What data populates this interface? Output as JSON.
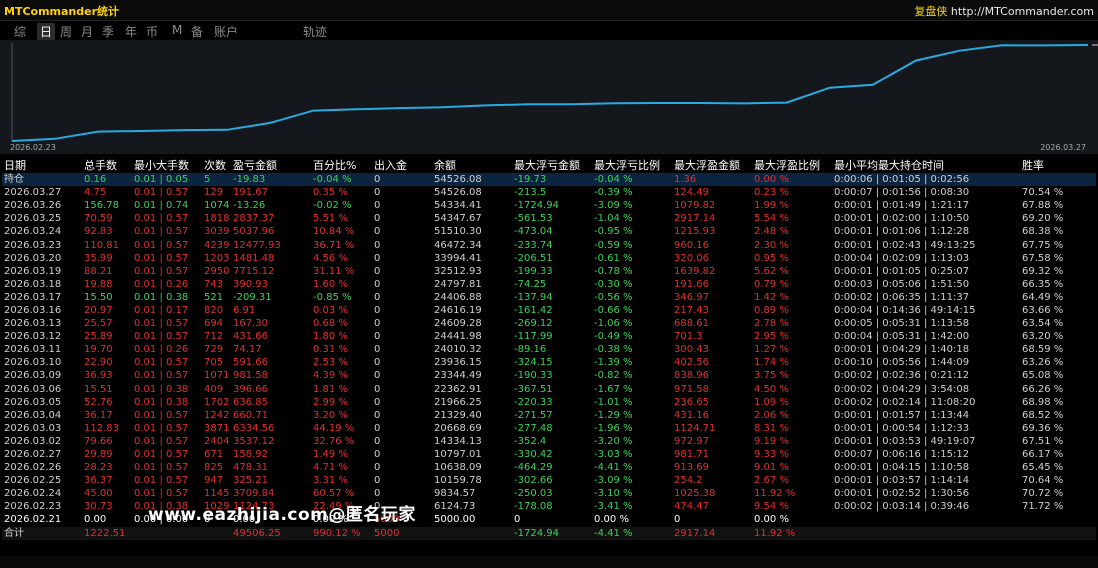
{
  "app": {
    "title": "MTCommander统计",
    "brand": "复盘侠",
    "site": "http://MTCommander.com"
  },
  "tabs": [
    {
      "label": "综",
      "active": false
    },
    {
      "label": "日",
      "active": true
    },
    {
      "label": "周",
      "active": false
    },
    {
      "label": "月",
      "active": false
    },
    {
      "label": "季",
      "active": false
    },
    {
      "label": "年",
      "active": false
    },
    {
      "label": "币",
      "active": false
    },
    {
      "label": "M",
      "active": false
    },
    {
      "label": "备",
      "active": false
    },
    {
      "label": "账户",
      "active": false
    },
    {
      "label": "轨迹",
      "active": false
    }
  ],
  "chart_data": {
    "type": "line",
    "x": [
      "2026.02.21",
      "2026.02.23",
      "2026.02.24",
      "2026.02.25",
      "2026.02.26",
      "2026.02.27",
      "2026.03.02",
      "2026.03.03",
      "2026.03.04",
      "2026.03.05",
      "2026.03.06",
      "2026.03.09",
      "2026.03.10",
      "2026.03.11",
      "2026.03.12",
      "2026.03.13",
      "2026.03.16",
      "2026.03.17",
      "2026.03.18",
      "2026.03.19",
      "2026.03.20",
      "2026.03.23",
      "2026.03.24",
      "2026.03.25",
      "2026.03.26",
      "2026.03.27"
    ],
    "values": [
      5000.0,
      6124.73,
      9834.57,
      10159.78,
      10638.09,
      10797.01,
      14334.13,
      20668.69,
      21329.4,
      21966.25,
      22362.91,
      23344.49,
      23936.15,
      24010.32,
      24441.98,
      24609.28,
      24616.19,
      24406.88,
      24797.81,
      32512.93,
      33994.41,
      46472.34,
      51510.3,
      54347.67,
      54334.41,
      54526.08
    ],
    "x_start_label": "2026.02.23",
    "x_end_label": "2026.03.27",
    "color": "#29abe2"
  },
  "table": {
    "headers": [
      "日期",
      "总手数",
      "最小大手数",
      "次数",
      "盈亏金额",
      "百分比%",
      "出入金",
      "余额",
      "最大浮亏金额",
      "最大浮亏比例",
      "最大浮盈金额",
      "最大浮盈比例",
      "最小平均最大持仓时间",
      "胜率"
    ],
    "holding": {
      "date": "持仓",
      "lots": "0.16",
      "minmax": "0.01 | 0.05",
      "count": "5",
      "pnl": "-19.83",
      "pct": "-0.04 %",
      "io": "0",
      "balance": "54526.08",
      "maxdd": "-19.73",
      "maxdd_pct": "-0.04 %",
      "maxfp": "1.36",
      "maxfp_pct": "0.00 %",
      "hold": "0:00:06 | 0:01:05 | 0:02:56",
      "win": ""
    },
    "rows": [
      {
        "date": "2026.03.27",
        "lots": "4.75",
        "minmax": "0.01 | 0.57",
        "count": "129",
        "pnl": "191.67",
        "pct": "0.35 %",
        "io": "0",
        "balance": "54526.08",
        "maxdd": "-213.5",
        "maxdd_pct": "-0.39 %",
        "maxfp": "124.49",
        "maxfp_pct": "0.23 %",
        "hold": "0:00:07 | 0:01:56 | 0:08:30",
        "win": "70.54 %"
      },
      {
        "date": "2026.03.26",
        "lots": "156.78",
        "minmax": "0.01 | 0.74",
        "count": "1074",
        "pnl": "-13.26",
        "pct": "-0.02 %",
        "io": "0",
        "balance": "54334.41",
        "maxdd": "-1724.94",
        "maxdd_pct": "-3.09 %",
        "maxfp": "1079.82",
        "maxfp_pct": "1.99 %",
        "hold": "0:00:01 | 0:01:49 | 1:21:17",
        "win": "67.88 %"
      },
      {
        "date": "2026.03.25",
        "lots": "70.59",
        "minmax": "0.01 | 0.57",
        "count": "1818",
        "pnl": "2837.37",
        "pct": "5.51 %",
        "io": "0",
        "balance": "54347.67",
        "maxdd": "-561.53",
        "maxdd_pct": "-1.04 %",
        "maxfp": "2917.14",
        "maxfp_pct": "5.54 %",
        "hold": "0:00:01 | 0:02:00 | 1:10:50",
        "win": "69.20 %"
      },
      {
        "date": "2026.03.24",
        "lots": "92.83",
        "minmax": "0.01 | 0.57",
        "count": "3039",
        "pnl": "5037.96",
        "pct": "10.84 %",
        "io": "0",
        "balance": "51510.30",
        "maxdd": "-473.04",
        "maxdd_pct": "-0.95 %",
        "maxfp": "1215.93",
        "maxfp_pct": "2.48 %",
        "hold": "0:00:01 | 0:01:06 | 1:12:28",
        "win": "68.38 %"
      },
      {
        "date": "2026.03.23",
        "lots": "110.81",
        "minmax": "0.01 | 0.57",
        "count": "4239",
        "pnl": "12477.93",
        "pct": "36.71 %",
        "io": "0",
        "balance": "46472.34",
        "maxdd": "-233.74",
        "maxdd_pct": "-0.59 %",
        "maxfp": "960.16",
        "maxfp_pct": "2.30 %",
        "hold": "0:00:01 | 0:02:43 | 49:13:25",
        "win": "67.75 %"
      },
      {
        "date": "2026.03.20",
        "lots": "35.99",
        "minmax": "0.01 | 0.57",
        "count": "1203",
        "pnl": "1481.48",
        "pct": "4.56 %",
        "io": "0",
        "balance": "33994.41",
        "maxdd": "-206.51",
        "maxdd_pct": "-0.61 %",
        "maxfp": "320.06",
        "maxfp_pct": "0.95 %",
        "hold": "0:00:04 | 0:02:09 | 1:13:03",
        "win": "67.58 %"
      },
      {
        "date": "2026.03.19",
        "lots": "88.21",
        "minmax": "0.01 | 0.57",
        "count": "2950",
        "pnl": "7715.12",
        "pct": "31.11 %",
        "io": "0",
        "balance": "32512.93",
        "maxdd": "-199.33",
        "maxdd_pct": "-0.78 %",
        "maxfp": "1639.82",
        "maxfp_pct": "5.62 %",
        "hold": "0:00:01 | 0:01:05 | 0:25:07",
        "win": "69.32 %"
      },
      {
        "date": "2026.03.18",
        "lots": "19.88",
        "minmax": "0.01 | 0.26",
        "count": "743",
        "pnl": "390.93",
        "pct": "1.60 %",
        "io": "0",
        "balance": "24797.81",
        "maxdd": "-74.25",
        "maxdd_pct": "-0.30 %",
        "maxfp": "191.66",
        "maxfp_pct": "0.79 %",
        "hold": "0:00:03 | 0:05:06 | 1:51:50",
        "win": "66.35 %"
      },
      {
        "date": "2026.03.17",
        "lots": "15.50",
        "minmax": "0.01 | 0.38",
        "count": "521",
        "pnl": "-209.31",
        "pct": "-0.85 %",
        "io": "0",
        "balance": "24406.88",
        "maxdd": "-137.94",
        "maxdd_pct": "-0.56 %",
        "maxfp": "346.97",
        "maxfp_pct": "1.42 %",
        "hold": "0:00:02 | 0:06:35 | 1:11:37",
        "win": "64.49 %"
      },
      {
        "date": "2026.03.16",
        "lots": "20.97",
        "minmax": "0.01 | 0.17",
        "count": "820",
        "pnl": "6.91",
        "pct": "0.03 %",
        "io": "0",
        "balance": "24616.19",
        "maxdd": "-161.42",
        "maxdd_pct": "-0.66 %",
        "maxfp": "217.43",
        "maxfp_pct": "0.89 %",
        "hold": "0:00:04 | 0:14:36 | 49:14:15",
        "win": "63.66 %"
      },
      {
        "date": "2026.03.13",
        "lots": "25.57",
        "minmax": "0.01 | 0.57",
        "count": "694",
        "pnl": "167.30",
        "pct": "0.68 %",
        "io": "0",
        "balance": "24609.28",
        "maxdd": "-269.12",
        "maxdd_pct": "-1.06 %",
        "maxfp": "688.61",
        "maxfp_pct": "2.78 %",
        "hold": "0:00:05 | 0:05:31 | 1:13:58",
        "win": "63.54 %"
      },
      {
        "date": "2026.03.12",
        "lots": "25.89",
        "minmax": "0.01 | 0.57",
        "count": "712",
        "pnl": "431.66",
        "pct": "1.80 %",
        "io": "0",
        "balance": "24441.98",
        "maxdd": "-117.99",
        "maxdd_pct": "-0.49 %",
        "maxfp": "701.3",
        "maxfp_pct": "2.95 %",
        "hold": "0:00:04 | 0:05:31 | 1:42:00",
        "win": "63.20 %"
      },
      {
        "date": "2026.03.11",
        "lots": "19.70",
        "minmax": "0.01 | 0.26",
        "count": "729",
        "pnl": "74.17",
        "pct": "0.31 %",
        "io": "0",
        "balance": "24010.32",
        "maxdd": "-89.16",
        "maxdd_pct": "-0.38 %",
        "maxfp": "300.43",
        "maxfp_pct": "1.27 %",
        "hold": "0:00:01 | 0:04:29 | 1:40:18",
        "win": "68.59 %"
      },
      {
        "date": "2026.03.10",
        "lots": "22.90",
        "minmax": "0.01 | 0.57",
        "count": "705",
        "pnl": "591.66",
        "pct": "2.53 %",
        "io": "0",
        "balance": "23936.15",
        "maxdd": "-324.15",
        "maxdd_pct": "-1.39 %",
        "maxfp": "402.56",
        "maxfp_pct": "1.74 %",
        "hold": "0:00:10 | 0:05:56 | 1:44:09",
        "win": "63.26 %"
      },
      {
        "date": "2026.03.09",
        "lots": "36.93",
        "minmax": "0.01 | 0.57",
        "count": "1071",
        "pnl": "981.58",
        "pct": "4.39 %",
        "io": "0",
        "balance": "23344.49",
        "maxdd": "-190.33",
        "maxdd_pct": "-0.82 %",
        "maxfp": "838.96",
        "maxfp_pct": "3.75 %",
        "hold": "0:00:02 | 0:02:36 | 0:21:12",
        "win": "65.08 %"
      },
      {
        "date": "2026.03.06",
        "lots": "15.51",
        "minmax": "0.01 | 0.38",
        "count": "409",
        "pnl": "396.66",
        "pct": "1.81 %",
        "io": "0",
        "balance": "22362.91",
        "maxdd": "-367.51",
        "maxdd_pct": "-1.67 %",
        "maxfp": "971.58",
        "maxfp_pct": "4.50 %",
        "hold": "0:00:02 | 0:04:29 | 3:54:08",
        "win": "66.26 %"
      },
      {
        "date": "2026.03.05",
        "lots": "52.76",
        "minmax": "0.01 | 0.38",
        "count": "1702",
        "pnl": "636.85",
        "pct": "2.99 %",
        "io": "0",
        "balance": "21966.25",
        "maxdd": "-220.33",
        "maxdd_pct": "-1.01 %",
        "maxfp": "236.65",
        "maxfp_pct": "1.09 %",
        "hold": "0:00:02 | 0:02:14 | 11:08:20",
        "win": "68.98 %"
      },
      {
        "date": "2026.03.04",
        "lots": "36.17",
        "minmax": "0.01 | 0.57",
        "count": "1242",
        "pnl": "660.71",
        "pct": "3.20 %",
        "io": "0",
        "balance": "21329.40",
        "maxdd": "-271.57",
        "maxdd_pct": "-1.29 %",
        "maxfp": "431.16",
        "maxfp_pct": "2.06 %",
        "hold": "0:00:01 | 0:01:57 | 1:13:44",
        "win": "68.52 %"
      },
      {
        "date": "2026.03.03",
        "lots": "112.83",
        "minmax": "0.01 | 0.57",
        "count": "3871",
        "pnl": "6334.56",
        "pct": "44.19 %",
        "io": "0",
        "balance": "20668.69",
        "maxdd": "-277.48",
        "maxdd_pct": "-1.96 %",
        "maxfp": "1124.71",
        "maxfp_pct": "8.31 %",
        "hold": "0:00:01 | 0:00:54 | 1:12:33",
        "win": "69.36 %"
      },
      {
        "date": "2026.03.02",
        "lots": "79.66",
        "minmax": "0.01 | 0.57",
        "count": "2404",
        "pnl": "3537.12",
        "pct": "32.76 %",
        "io": "0",
        "balance": "14334.13",
        "maxdd": "-352.4",
        "maxdd_pct": "-3.20 %",
        "maxfp": "972.97",
        "maxfp_pct": "9.19 %",
        "hold": "0:00:01 | 0:03:53 | 49:19:07",
        "win": "67.51 %"
      },
      {
        "date": "2026.02.27",
        "lots": "29.89",
        "minmax": "0.01 | 0.57",
        "count": "671",
        "pnl": "158.92",
        "pct": "1.49 %",
        "io": "0",
        "balance": "10797.01",
        "maxdd": "-330.42",
        "maxdd_pct": "-3.03 %",
        "maxfp": "981.71",
        "maxfp_pct": "9.33 %",
        "hold": "0:00:07 | 0:06:16 | 1:15:12",
        "win": "66.17 %"
      },
      {
        "date": "2026.02.26",
        "lots": "28.23",
        "minmax": "0.01 | 0.57",
        "count": "825",
        "pnl": "478.31",
        "pct": "4.71 %",
        "io": "0",
        "balance": "10638.09",
        "maxdd": "-464.29",
        "maxdd_pct": "-4.41 %",
        "maxfp": "913.69",
        "maxfp_pct": "9.01 %",
        "hold": "0:00:01 | 0:04:15 | 1:10:58",
        "win": "65.45 %"
      },
      {
        "date": "2026.02.25",
        "lots": "36.37",
        "minmax": "0.01 | 0.57",
        "count": "947",
        "pnl": "325.21",
        "pct": "3.31 %",
        "io": "0",
        "balance": "10159.78",
        "maxdd": "-302.66",
        "maxdd_pct": "-3.09 %",
        "maxfp": "254.2",
        "maxfp_pct": "2.67 %",
        "hold": "0:00:01 | 0:03:57 | 1:14:14",
        "win": "70.64 %"
      },
      {
        "date": "2026.02.24",
        "lots": "45.00",
        "minmax": "0.01 | 0.57",
        "count": "1145",
        "pnl": "3709.84",
        "pct": "60.57 %",
        "io": "0",
        "balance": "9834.57",
        "maxdd": "-250.03",
        "maxdd_pct": "-3.10 %",
        "maxfp": "1025.38",
        "maxfp_pct": "11.92 %",
        "hold": "0:00:01 | 0:02:52 | 1:30:56",
        "win": "70.72 %"
      },
      {
        "date": "2026.02.23",
        "lots": "30.73",
        "minmax": "0.01 | 0.38",
        "count": "1029",
        "pnl": "1124.73",
        "pct": "22.49 %",
        "io": "0",
        "balance": "6124.73",
        "maxdd": "-178.08",
        "maxdd_pct": "-3.41 %",
        "maxfp": "474.47",
        "maxfp_pct": "9.54 %",
        "hold": "0:00:02 | 0:03:14 | 0:39:46",
        "win": "71.72 %"
      },
      {
        "date": "2026.02.21",
        "lots": "0.00",
        "minmax": "0.00 | 0.00",
        "count": "0",
        "pnl": "0.00",
        "pct": "0.00 %",
        "io": "5000",
        "balance": "5000.00",
        "maxdd": "0",
        "maxdd_pct": "0.00 %",
        "maxfp": "0",
        "maxfp_pct": "0.00 %",
        "hold": "",
        "win": ""
      }
    ],
    "total": {
      "date": "合计",
      "lots": "1222.51",
      "minmax": "",
      "count": "",
      "pnl": "49506.25",
      "pct": "990.12 %",
      "io": "5000",
      "balance": "",
      "maxdd": "-1724.94",
      "maxdd_pct": "-4.41 %",
      "maxfp": "2917.14",
      "maxfp_pct": "11.92 %",
      "hold": "",
      "win": ""
    }
  },
  "watermark": "www.eazhijia.com@匿名玩家",
  "colors": {
    "positive": "#3cd25a",
    "negative": "#e03030",
    "line": "#29abe2",
    "title": "#ffd400"
  }
}
